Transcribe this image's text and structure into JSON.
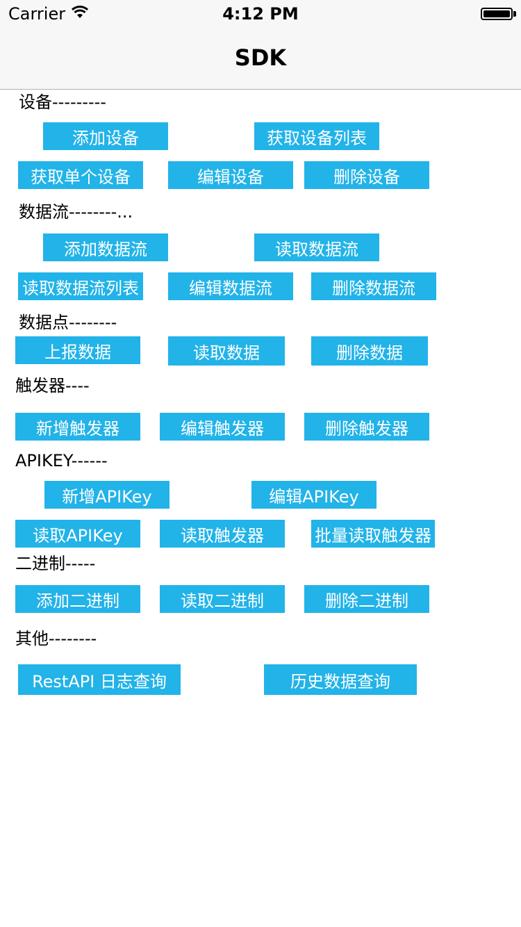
{
  "status": {
    "carrier": "Carrier",
    "time": "4:12 PM"
  },
  "nav": {
    "title": "SDK"
  },
  "sections": {
    "device": {
      "label": "设备---------",
      "add": "添加设备",
      "list": "获取设备列表",
      "get_one": "获取单个设备",
      "edit": "编辑设备",
      "delete": "删除设备"
    },
    "datastream": {
      "label": "数据流--------...",
      "add": "添加数据流",
      "read": "读取数据流",
      "read_list": "读取数据流列表",
      "edit": "编辑数据流",
      "delete": "删除数据流"
    },
    "datapoint": {
      "label": "数据点--------",
      "report": "上报数据",
      "read": "读取数据",
      "delete": "删除数据"
    },
    "trigger": {
      "label": "触发器----",
      "add": "新增触发器",
      "edit": "编辑触发器",
      "delete": "删除触发器"
    },
    "apikey": {
      "label": "APIKEY------",
      "add": "新增APIKey",
      "edit": "编辑APIKey",
      "read": "读取APIKey",
      "read_trigger": "读取触发器",
      "batch_read_trigger": "批量读取触发器"
    },
    "binary": {
      "label": "二进制-----",
      "add": "添加二进制",
      "read": "读取二进制",
      "delete": "删除二进制"
    },
    "other": {
      "label": "其他--------",
      "restapi_log": "RestAPI 日志查询",
      "history_query": "历史数据查询"
    }
  },
  "colors": {
    "button": "#22b3e8",
    "button_text": "#ffffff",
    "nav_bg": "#f7f7f7"
  }
}
